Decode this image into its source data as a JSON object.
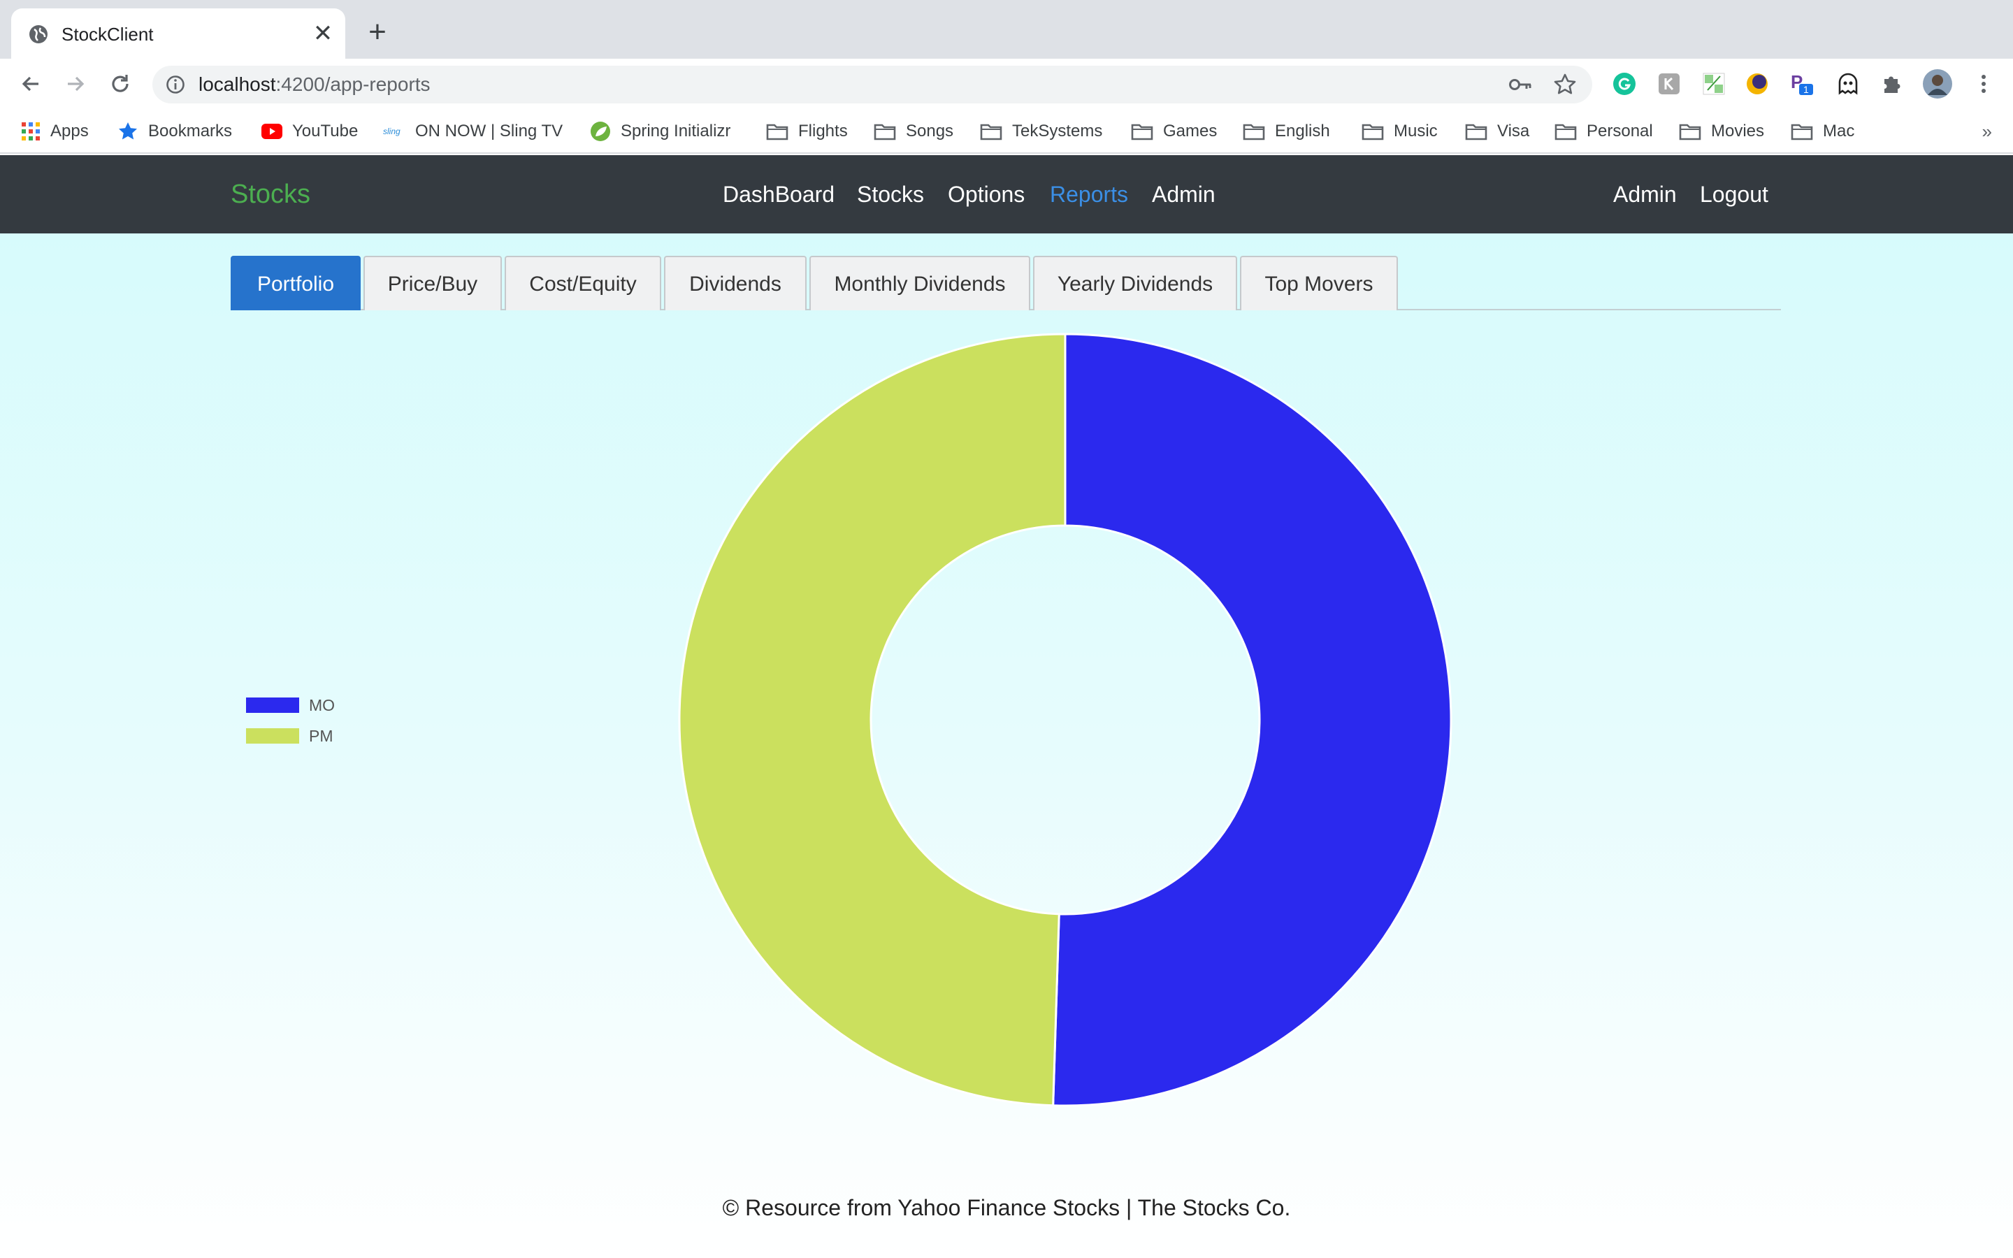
{
  "browser": {
    "tab_title": "StockClient",
    "url_host": "localhost",
    "url_path": ":4200/app-reports",
    "bookmarks": [
      "Apps",
      "Bookmarks",
      "YouTube",
      "ON NOW | Sling TV",
      "Spring Initializr",
      "Flights",
      "Songs",
      "TekSystems",
      "Games",
      "English",
      "Music",
      "Visa",
      "Personal",
      "Movies",
      "Mac"
    ],
    "bookmarks_more": "»",
    "ext_badge": "1"
  },
  "navbar": {
    "brand": "Stocks",
    "links": [
      "DashBoard",
      "Stocks",
      "Options",
      "Reports",
      "Admin"
    ],
    "active_link": "Reports",
    "right_links": [
      "Admin",
      "Logout"
    ],
    "brand_color": "#4caf50",
    "active_color": "#3b8fe6"
  },
  "report_tabs": {
    "items": [
      "Portfolio",
      "Price/Buy",
      "Cost/Equity",
      "Dividends",
      "Monthly Dividends",
      "Yearly Dividends",
      "Top Movers"
    ],
    "active": "Portfolio"
  },
  "chart_data": {
    "type": "pie",
    "variant": "doughnut",
    "categories": [
      "MO",
      "PM"
    ],
    "values": [
      50.5,
      49.5
    ],
    "colors": [
      "#2b29ee",
      "#cbe05e"
    ],
    "legend_position": "left"
  },
  "footer": {
    "text": "© Resource from Yahoo Finance Stocks | The Stocks Co."
  }
}
